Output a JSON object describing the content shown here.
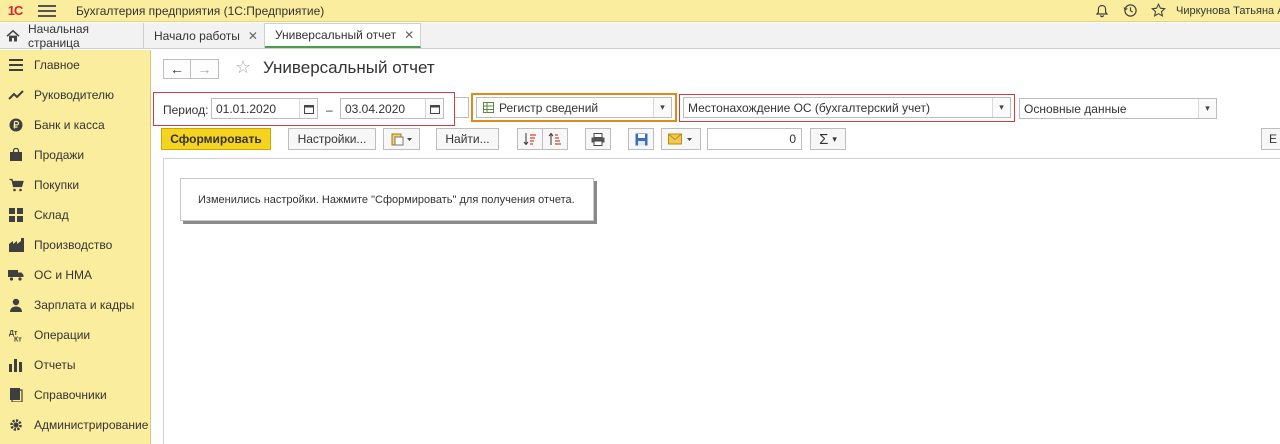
{
  "titlebar": {
    "logo": "1С",
    "app_title": "Бухгалтерия предприятия   (1С:Предприятие)",
    "user": "Чиркунова Татьяна Алексеевна",
    "icons": [
      "bell-icon",
      "history-icon",
      "star-icon"
    ]
  },
  "tabs": {
    "home": "Начальная страница",
    "items": [
      {
        "label": "Начало работы"
      },
      {
        "label": "Универсальный отчет"
      }
    ]
  },
  "sidebar": {
    "items": [
      {
        "label": "Главное",
        "icon": "menu-icon"
      },
      {
        "label": "Руководителю",
        "icon": "trend-icon"
      },
      {
        "label": "Банк и касса",
        "icon": "ruble-icon"
      },
      {
        "label": "Продажи",
        "icon": "bag-icon"
      },
      {
        "label": "Покупки",
        "icon": "cart-icon"
      },
      {
        "label": "Склад",
        "icon": "warehouse-icon"
      },
      {
        "label": "Производство",
        "icon": "factory-icon"
      },
      {
        "label": "ОС и НМА",
        "icon": "truck-icon"
      },
      {
        "label": "Зарплата и кадры",
        "icon": "person-icon"
      },
      {
        "label": "Операции",
        "icon": "dt-kt-icon"
      },
      {
        "label": "Отчеты",
        "icon": "bar-chart-icon"
      },
      {
        "label": "Справочники",
        "icon": "books-icon"
      },
      {
        "label": "Администрирование",
        "icon": "gear-icon"
      }
    ]
  },
  "main": {
    "title": "Универсальный отчет",
    "period_label": "Период:",
    "date_from": "01.01.2020",
    "date_to": "03.04.2020",
    "dash": "–",
    "source_type": "Регистр сведений",
    "source": "Местонахождение ОС (бухгалтерский учет)",
    "data_set": "Основные данные",
    "toolbar": {
      "generate": "Сформировать",
      "settings": "Настройки...",
      "find": "Найти...",
      "number": "0",
      "edge": "Е"
    },
    "notice": "Изменились настройки. Нажмите \"Сформировать\" для получения отчета."
  }
}
